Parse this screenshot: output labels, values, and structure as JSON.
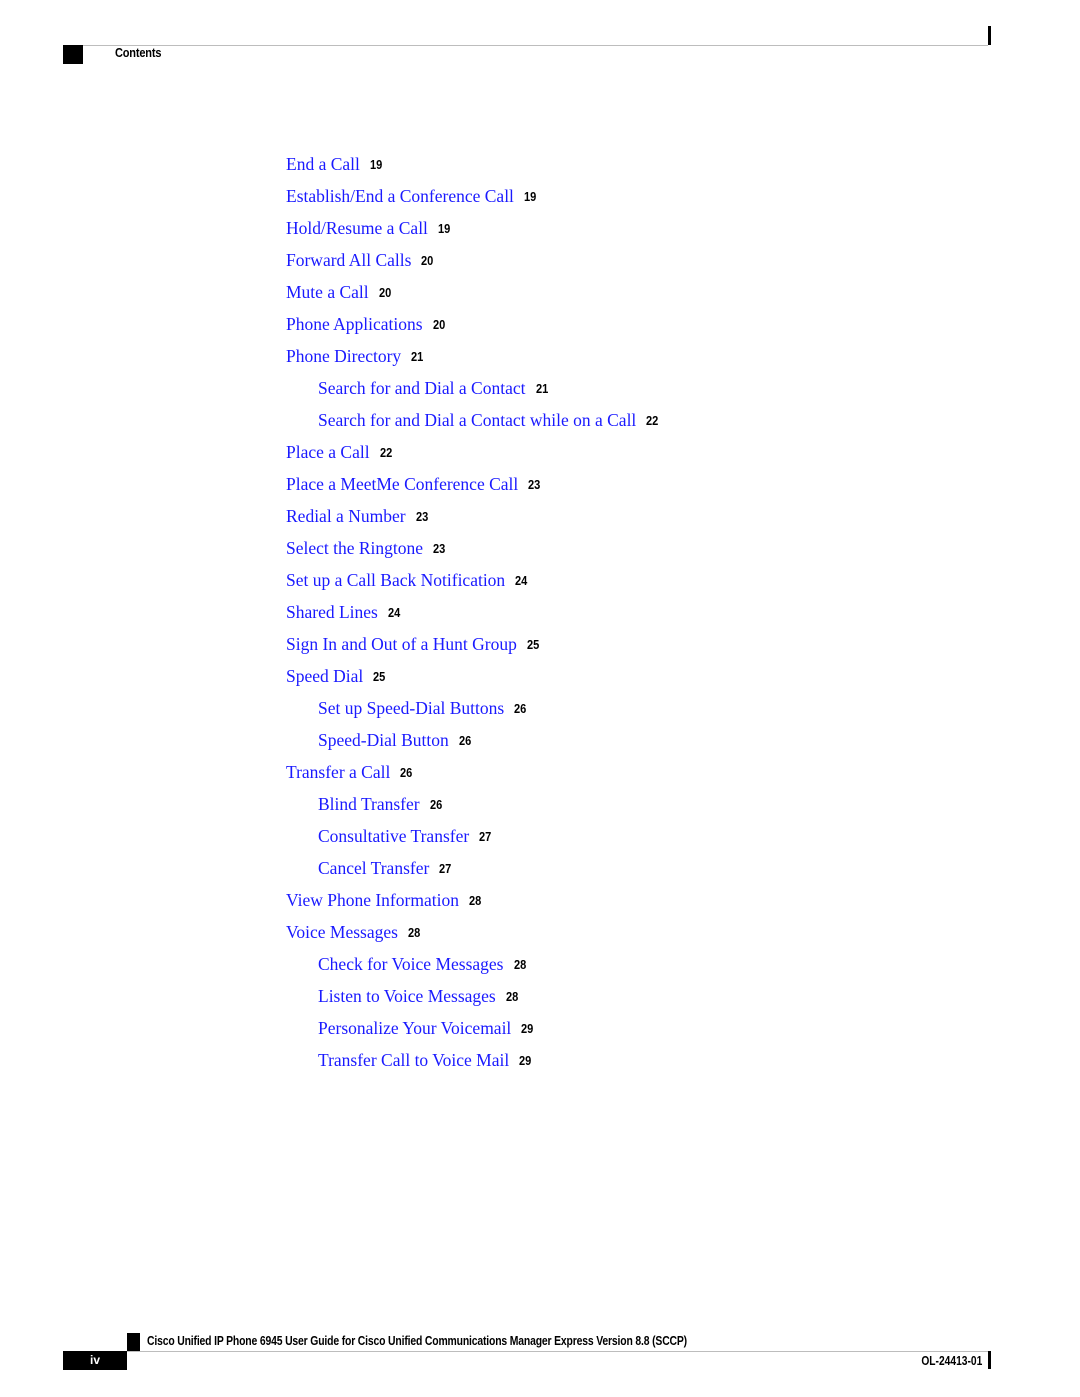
{
  "header": {
    "section_title": "Contents"
  },
  "toc": {
    "entries": [
      {
        "title": "End a Call",
        "page": "19",
        "level": 1
      },
      {
        "title": "Establish/End a Conference Call",
        "page": "19",
        "level": 1
      },
      {
        "title": "Hold/Resume a Call",
        "page": "19",
        "level": 1
      },
      {
        "title": "Forward All Calls",
        "page": "20",
        "level": 1
      },
      {
        "title": "Mute a Call",
        "page": "20",
        "level": 1
      },
      {
        "title": "Phone Applications",
        "page": "20",
        "level": 1
      },
      {
        "title": "Phone Directory",
        "page": "21",
        "level": 1
      },
      {
        "title": "Search for and Dial a Contact",
        "page": "21",
        "level": 2
      },
      {
        "title": "Search for and Dial a Contact while on a Call",
        "page": "22",
        "level": 2
      },
      {
        "title": "Place a Call",
        "page": "22",
        "level": 1
      },
      {
        "title": "Place a MeetMe Conference Call",
        "page": "23",
        "level": 1
      },
      {
        "title": "Redial a Number",
        "page": "23",
        "level": 1
      },
      {
        "title": "Select the Ringtone",
        "page": "23",
        "level": 1
      },
      {
        "title": "Set up a Call Back Notification",
        "page": "24",
        "level": 1
      },
      {
        "title": "Shared Lines",
        "page": "24",
        "level": 1
      },
      {
        "title": "Sign In and Out of a Hunt Group",
        "page": "25",
        "level": 1
      },
      {
        "title": "Speed Dial",
        "page": "25",
        "level": 1
      },
      {
        "title": "Set up Speed-Dial Buttons",
        "page": "26",
        "level": 2
      },
      {
        "title": "Speed-Dial Button",
        "page": "26",
        "level": 2
      },
      {
        "title": "Transfer a Call",
        "page": "26",
        "level": 1
      },
      {
        "title": "Blind Transfer",
        "page": "26",
        "level": 2
      },
      {
        "title": "Consultative Transfer",
        "page": "27",
        "level": 2
      },
      {
        "title": "Cancel Transfer",
        "page": "27",
        "level": 2
      },
      {
        "title": "View Phone Information",
        "page": "28",
        "level": 1
      },
      {
        "title": "Voice Messages",
        "page": "28",
        "level": 1
      },
      {
        "title": "Check for Voice Messages",
        "page": "28",
        "level": 2
      },
      {
        "title": "Listen to Voice Messages",
        "page": "28",
        "level": 2
      },
      {
        "title": "Personalize Your Voicemail",
        "page": "29",
        "level": 2
      },
      {
        "title": "Transfer Call to Voice Mail",
        "page": "29",
        "level": 2
      }
    ]
  },
  "footer": {
    "book_title": "Cisco Unified IP Phone 6945 User Guide for Cisco Unified Communications Manager Express Version 8.8 (SCCP)",
    "page_number": "iv",
    "doc_number": "OL-24413-01"
  },
  "colors": {
    "link": "#1a1aff",
    "text": "#000000",
    "rule": "#bdbdbd"
  }
}
